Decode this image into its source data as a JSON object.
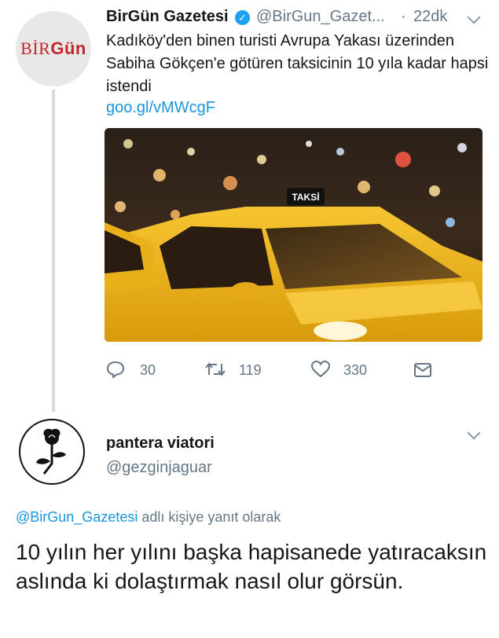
{
  "tweet": {
    "author_name": "BirGün Gazetesi",
    "handle": "@BirGun_Gazet...",
    "separator": "·",
    "time": "22dk",
    "avatar_logo_part1": "BİR",
    "avatar_logo_part2": "Gün",
    "verified_mark": "✓",
    "text": "Kadıköy'den binen turisti Avrupa Yakası üzerinden Sabiha Gökçen'e götüren taksicinin 10 yıla kadar hapsi istendi",
    "link": "goo.gl/vMWcgF",
    "image": {
      "sign_text": "TAKSİ",
      "subject": "yellow taxi at night"
    },
    "actions": {
      "reply_count": "30",
      "retweet_count": "119",
      "like_count": "330"
    }
  },
  "reply": {
    "author_name": "pantera viatori",
    "handle": "@gezginjaguar",
    "replying_to_mention": "@BirGun_Gazetesi",
    "replying_to_suffix": " adlı kişiye yanıt olarak",
    "text": "10 yılın her yılını başka hapisanede yatıracaksın aslında ki dolaştırmak nasıl olur görsün."
  },
  "colors": {
    "link": "#1b95e0",
    "secondary_text": "#657786",
    "verified": "#1da1f2",
    "brand_red": "#c4262e"
  }
}
